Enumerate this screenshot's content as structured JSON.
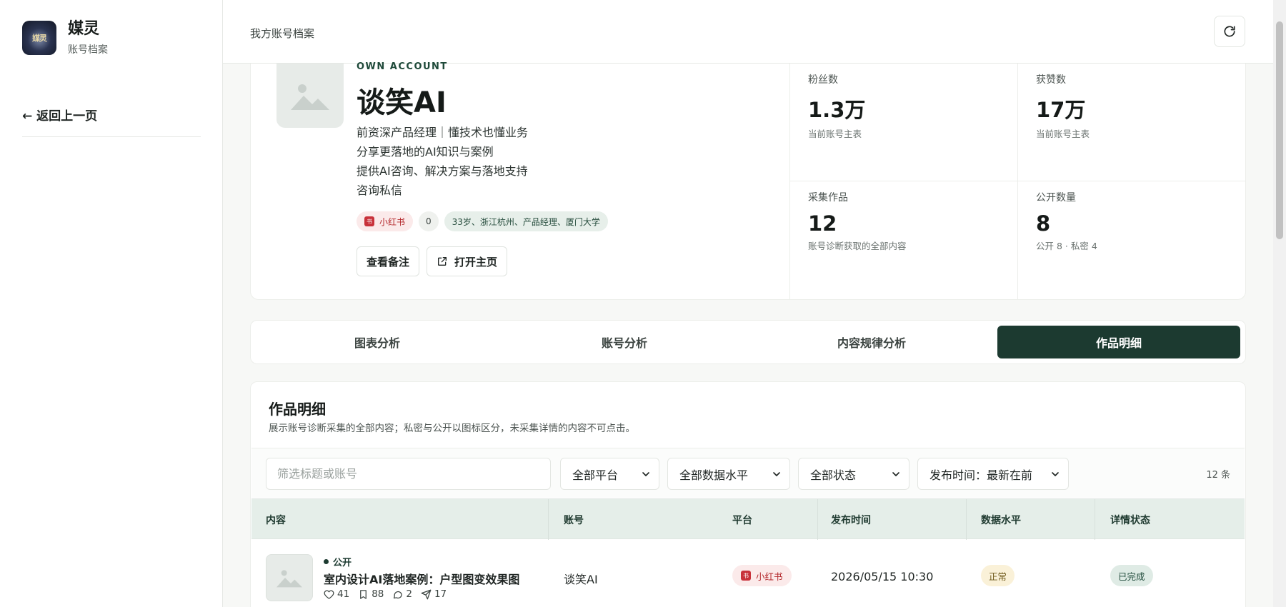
{
  "brand": {
    "logo_text": "媒灵",
    "title": "媒灵",
    "subtitle": "账号档案"
  },
  "sidebar": {
    "back_label": "← 返回上一页"
  },
  "topbar": {
    "title": "我方账号档案"
  },
  "profile": {
    "tag": "OWN ACCOUNT",
    "name": "谈笑AI",
    "bio": [
      "前资深产品经理｜懂技术也懂业务",
      "分享更落地的AI知识与案例",
      "提供AI咨询、解决方案与落地支持",
      "咨询私信"
    ],
    "platform_tag": "小红书",
    "count_tag": "0",
    "info_tag": "33岁、浙江杭州、产品经理、厦门大学",
    "btn_notes": "查看备注",
    "btn_open": "打开主页"
  },
  "stats": [
    {
      "label": "粉丝数",
      "value": "1.3万",
      "note": "当前账号主表"
    },
    {
      "label": "获赞数",
      "value": "17万",
      "note": "当前账号主表"
    },
    {
      "label": "采集作品",
      "value": "12",
      "note": "账号诊断获取的全部内容"
    },
    {
      "label": "公开数量",
      "value": "8",
      "note": "公开 8 · 私密 4"
    }
  ],
  "tabs": [
    "图表分析",
    "账号分析",
    "内容规律分析",
    "作品明细"
  ],
  "works": {
    "title": "作品明细",
    "desc": "展示账号诊断采集的全部内容；私密与公开以图标区分，未采集详情的内容不可点击。",
    "search_placeholder": "筛选标题或账号",
    "filters": {
      "platform": "全部平台",
      "level": "全部数据水平",
      "status": "全部状态",
      "time": "发布时间：最新在前"
    },
    "count": "12 条",
    "headers": [
      "内容",
      "账号",
      "平台",
      "发布时间",
      "数据水平",
      "详情状态"
    ],
    "rows": [
      {
        "visibility": "公开",
        "title": "室内设计AI落地案例：户型图变效果图",
        "likes": "41",
        "collects": "88",
        "comments": "2",
        "shares": "17",
        "account": "谈笑AI",
        "platform": "小红书",
        "time": "2026/05/15 10:30",
        "level": "正常",
        "status": "已完成"
      }
    ]
  },
  "colors": {
    "accent": "#1c3a30",
    "xhs": "#c8313a"
  },
  "icons": {
    "refresh": "refresh-icon",
    "external": "external-link-icon",
    "image": "image-placeholder-icon"
  }
}
